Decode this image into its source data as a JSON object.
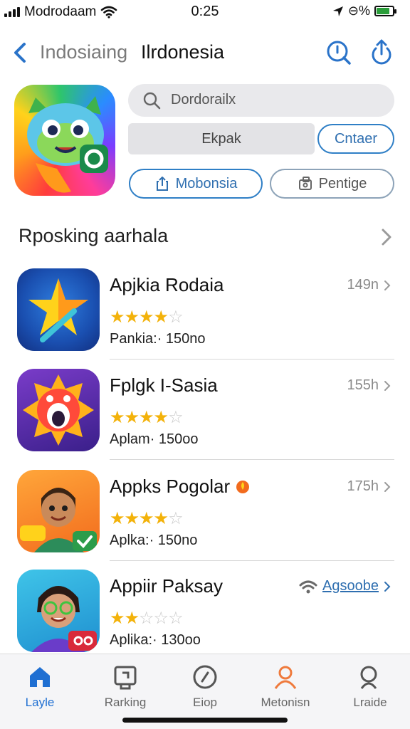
{
  "status": {
    "carrier": "Modrodaam",
    "time": "0:25",
    "battery_text": "⊖%",
    "battery_level": 0.8,
    "battery_color": "#2a9d3a"
  },
  "nav": {
    "back_icon": "chevron-left-icon",
    "subtitle": "Indosiaing",
    "title": "Ilrdonesia",
    "search_icon": "search-icon",
    "share_icon": "share-icon"
  },
  "app": {
    "search_placeholder": "Dordorailx",
    "get_label": "Ekpak",
    "open_label": "Cntaer",
    "btn_left": "Mobonsia",
    "btn_right": "Pentige"
  },
  "section": {
    "title": "Rposking aarhala"
  },
  "apps": [
    {
      "name": "Apjkia Rodaia",
      "rating": 4,
      "meta": "Pankia:· 150no",
      "side": "149n",
      "side_link": false
    },
    {
      "name": "Fplgk I-Sasia",
      "rating": 4,
      "meta": "Aplam· 150oo",
      "side": "155h",
      "side_link": false
    },
    {
      "name": "Appks Pogolar",
      "rating": 4,
      "meta": "Aplka:· 150no",
      "side": "175h",
      "side_link": false
    },
    {
      "name": "Appiir Paksay",
      "rating": 2,
      "meta": "Aplika:· 130oo",
      "side": "Agsoobe",
      "side_link": true
    }
  ],
  "tabs": [
    {
      "label": "Layle",
      "icon": "home-icon",
      "active": true
    },
    {
      "label": "Rarking",
      "icon": "ranking-icon",
      "active": false
    },
    {
      "label": "Eiop",
      "icon": "compass-icon",
      "active": false
    },
    {
      "label": "Metonisn",
      "icon": "person-icon",
      "active": false
    },
    {
      "label": "Lraide",
      "icon": "search-icon",
      "active": false
    }
  ],
  "colors": {
    "accent": "#1f6fd2",
    "star": "#f3b20a",
    "tab_orange": "#ef7a3c"
  }
}
